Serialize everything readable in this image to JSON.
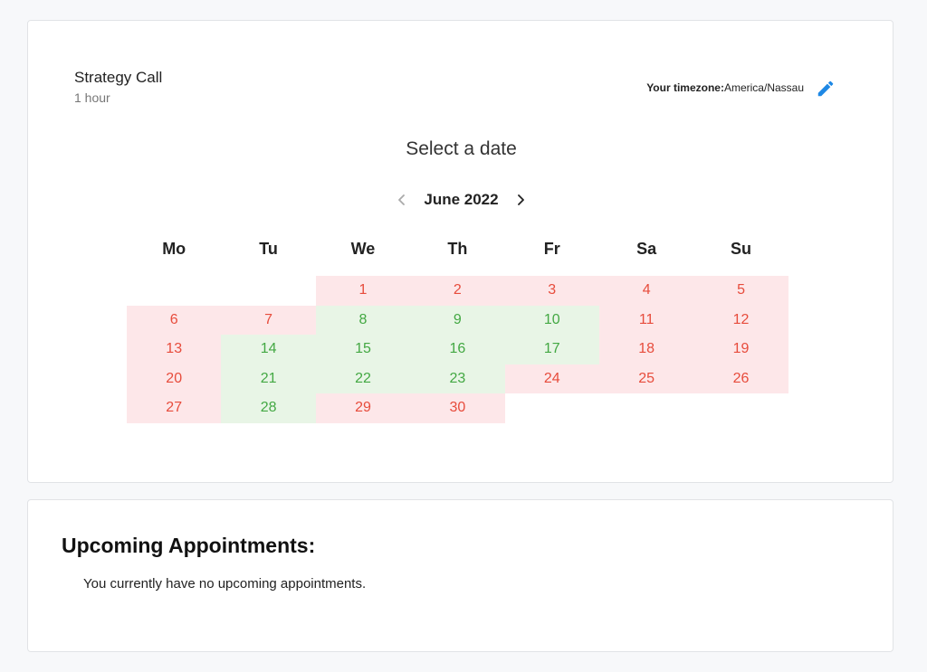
{
  "event": {
    "title": "Strategy Call",
    "duration": "1 hour"
  },
  "timezone": {
    "label": "Your timezone:",
    "value": "America/Nassau"
  },
  "calendar": {
    "heading": "Select a date",
    "month_label": "June 2022",
    "weekdays": [
      "Mo",
      "Tu",
      "We",
      "Th",
      "Fr",
      "Sa",
      "Su"
    ],
    "leading_blank_days": 2,
    "days": [
      {
        "day": "1",
        "status": "unavailable"
      },
      {
        "day": "2",
        "status": "unavailable"
      },
      {
        "day": "3",
        "status": "unavailable"
      },
      {
        "day": "4",
        "status": "unavailable"
      },
      {
        "day": "5",
        "status": "unavailable"
      },
      {
        "day": "6",
        "status": "unavailable"
      },
      {
        "day": "7",
        "status": "unavailable"
      },
      {
        "day": "8",
        "status": "available"
      },
      {
        "day": "9",
        "status": "available"
      },
      {
        "day": "10",
        "status": "available"
      },
      {
        "day": "11",
        "status": "unavailable"
      },
      {
        "day": "12",
        "status": "unavailable"
      },
      {
        "day": "13",
        "status": "unavailable"
      },
      {
        "day": "14",
        "status": "available"
      },
      {
        "day": "15",
        "status": "available"
      },
      {
        "day": "16",
        "status": "available"
      },
      {
        "day": "17",
        "status": "available"
      },
      {
        "day": "18",
        "status": "unavailable"
      },
      {
        "day": "19",
        "status": "unavailable"
      },
      {
        "day": "20",
        "status": "unavailable"
      },
      {
        "day": "21",
        "status": "available"
      },
      {
        "day": "22",
        "status": "available"
      },
      {
        "day": "23",
        "status": "available"
      },
      {
        "day": "24",
        "status": "unavailable"
      },
      {
        "day": "25",
        "status": "unavailable"
      },
      {
        "day": "26",
        "status": "unavailable"
      },
      {
        "day": "27",
        "status": "unavailable"
      },
      {
        "day": "28",
        "status": "available"
      },
      {
        "day": "29",
        "status": "unavailable"
      },
      {
        "day": "30",
        "status": "unavailable"
      }
    ]
  },
  "appointments": {
    "title": "Upcoming Appointments:",
    "empty_message": "You currently have no upcoming appointments."
  },
  "colors": {
    "unavailable_bg": "#fde7e9",
    "unavailable_text": "#e74c3c",
    "available_bg": "#e8f5e6",
    "available_text": "#43a843",
    "accent": "#1e88e5"
  },
  "icons": {
    "edit": "pencil-icon",
    "prev": "chevron-left-icon",
    "next": "chevron-right-icon"
  }
}
